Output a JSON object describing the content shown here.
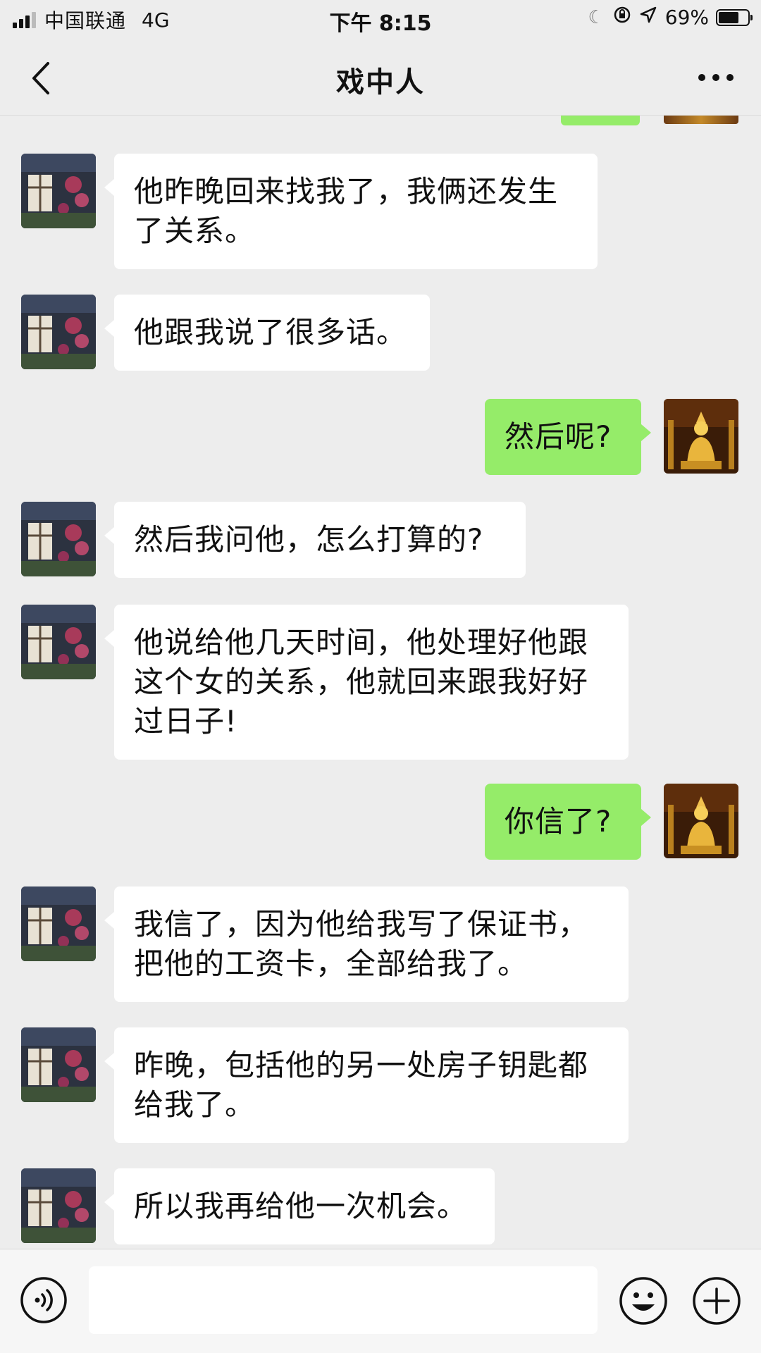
{
  "status_bar": {
    "carrier": "中国联通",
    "network": "4G",
    "time": "下午 8:15",
    "battery_text": "69%",
    "battery_level": 0.69
  },
  "header": {
    "title": "戏中人",
    "more_label": "···"
  },
  "colors": {
    "outgoing_bubble": "#95ec69",
    "incoming_bubble": "#ffffff",
    "background": "#ededed"
  },
  "messages": [
    {
      "side": "in",
      "text": "他昨晚回来找我了，我俩还发生了关系。"
    },
    {
      "side": "in",
      "text": "他跟我说了很多话。"
    },
    {
      "side": "out",
      "text": "然后呢?"
    },
    {
      "side": "in",
      "text": "然后我问他，怎么打算的?"
    },
    {
      "side": "in",
      "text": "他说给他几天时间，他处理好他跟这个女的关系，他就回来跟我好好过日子!"
    },
    {
      "side": "out",
      "text": "你信了?"
    },
    {
      "side": "in",
      "text": "我信了，因为他给我写了保证书，把他的工资卡，全部给我了。"
    },
    {
      "side": "in",
      "text": "昨晚，包括他的另一处房子钥匙都给我了。"
    },
    {
      "side": "in",
      "text": "所以我再给他一次机会。"
    }
  ],
  "input_bar": {
    "value": "",
    "icons": [
      "voice-icon",
      "emoji-icon",
      "plus-icon"
    ]
  }
}
